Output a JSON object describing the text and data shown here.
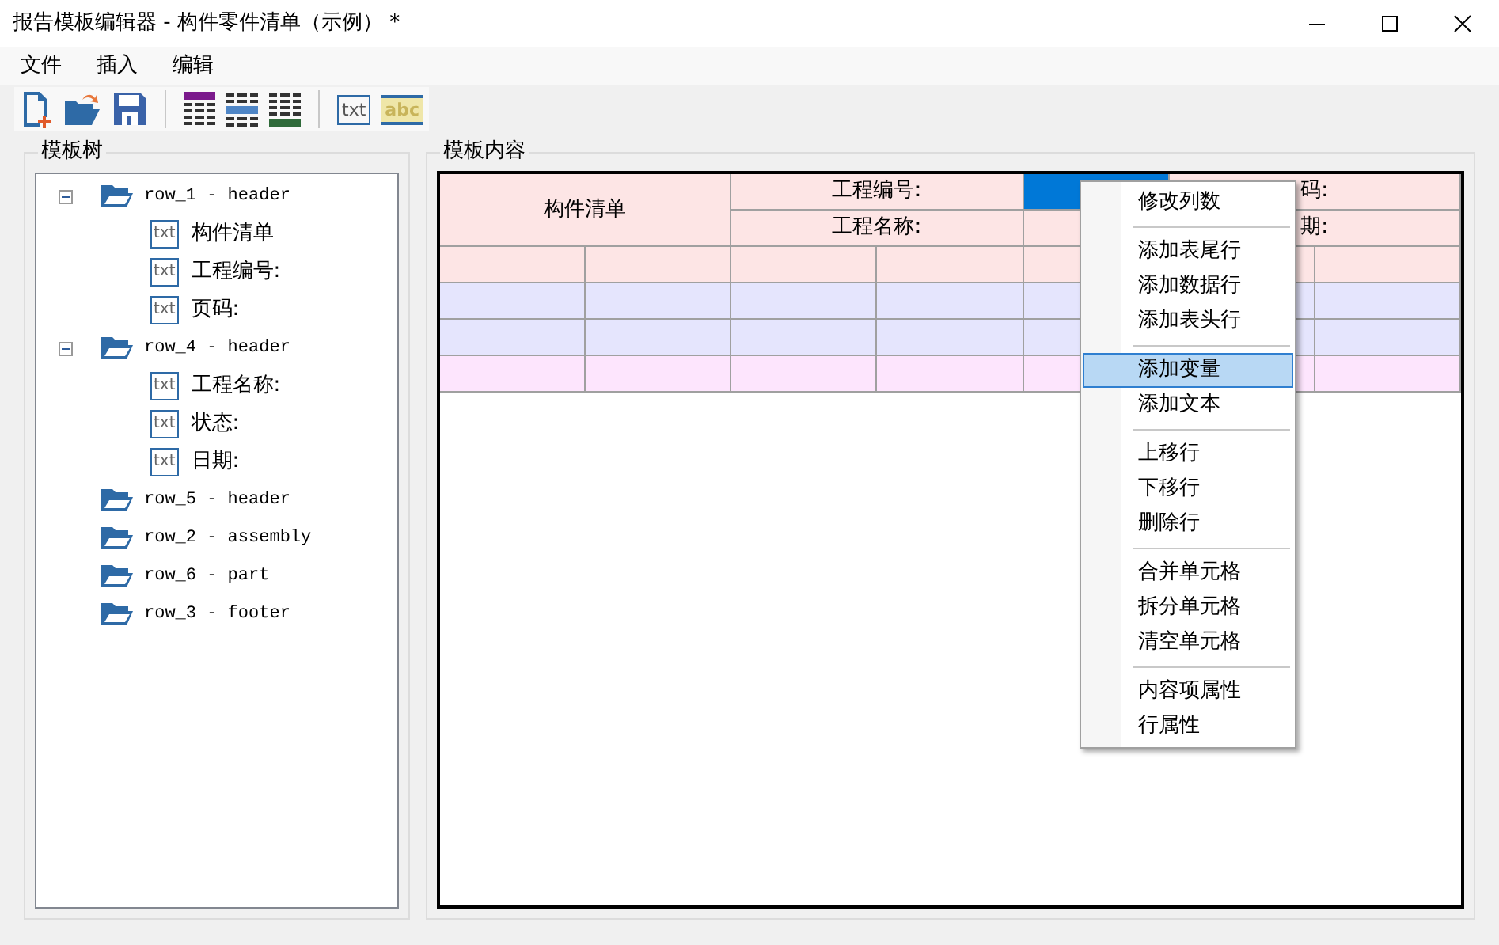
{
  "window": {
    "title": "报告模板编辑器 - 构件零件清单（示例） *"
  },
  "menu_bar": [
    "文件",
    "插入",
    "编辑"
  ],
  "toolbar": [
    {
      "kind": "new"
    },
    {
      "kind": "open"
    },
    {
      "kind": "save"
    },
    {
      "kind": "separator"
    },
    {
      "kind": "table-top"
    },
    {
      "kind": "table-middle"
    },
    {
      "kind": "table-bottom"
    },
    {
      "kind": "separator"
    },
    {
      "kind": "text",
      "label": "txt"
    },
    {
      "kind": "variable",
      "label": "abc"
    }
  ],
  "tree_panel": {
    "title": "模板树",
    "items": [
      {
        "label": "row_1 - header",
        "expanded": true,
        "children": [
          {
            "label": "构件清单",
            "badge": "txt"
          },
          {
            "label": "工程编号:",
            "badge": "txt"
          },
          {
            "label": "页码:",
            "badge": "txt"
          }
        ]
      },
      {
        "label": "row_4 - header",
        "expanded": true,
        "children": [
          {
            "label": "工程名称:",
            "badge": "txt"
          },
          {
            "label": "状态:",
            "badge": "txt"
          },
          {
            "label": "日期:",
            "badge": "txt"
          }
        ]
      },
      {
        "label": "row_5 - header"
      },
      {
        "label": "row_2 - assembly"
      },
      {
        "label": "row_6 - part"
      },
      {
        "label": "row_3 - footer"
      }
    ]
  },
  "content_panel": {
    "title": "模板内容",
    "table": {
      "rows": [
        {
          "color": "#fde5e5",
          "cells": [
            {
              "kind": "block",
              "text": "构件清单",
              "selected": false
            },
            {
              "kind": "wide",
              "text": "工程编号:",
              "selected": false
            },
            {
              "kind": "cell",
              "selected": true
            },
            {
              "kind": "wide",
              "text": "码:",
              "selected": false
            }
          ]
        },
        {
          "color": "#fde5e5",
          "cells": [
            {
              "kind": "merged"
            },
            {
              "kind": "wide",
              "text": "工程名称:",
              "selected": false
            },
            {
              "kind": "cell",
              "selected": false
            },
            {
              "kind": "wide",
              "text": "期:",
              "selected": false
            }
          ]
        },
        {
          "color": "#fde5e5",
          "cells": [
            {
              "selected": false
            },
            {
              "selected": false
            },
            {
              "selected": false
            },
            {
              "selected": false
            },
            {
              "selected": false
            },
            {
              "selected": false
            },
            {
              "selected": false
            }
          ]
        },
        {
          "color": "#e5e5fd",
          "cells": [
            {
              "selected": false
            },
            {
              "selected": false
            },
            {
              "selected": false
            },
            {
              "selected": false
            },
            {
              "selected": false
            },
            {
              "selected": false
            },
            {
              "selected": false
            }
          ]
        },
        {
          "color": "#e5e5fd",
          "cells": [
            {
              "selected": false
            },
            {
              "selected": false
            },
            {
              "selected": false
            },
            {
              "selected": false
            },
            {
              "selected": false
            },
            {
              "selected": false
            },
            {
              "selected": false
            }
          ]
        },
        {
          "color": "#fde5fd",
          "cells": [
            {
              "selected": false
            },
            {
              "selected": false
            },
            {
              "selected": false
            },
            {
              "selected": false
            },
            {
              "selected": false
            },
            {
              "selected": false
            },
            {
              "selected": false
            }
          ]
        }
      ]
    }
  },
  "context_menu": {
    "groups": [
      [
        {
          "label": "修改列数",
          "selected": false
        }
      ],
      [
        {
          "label": "添加表尾行",
          "selected": false
        },
        {
          "label": "添加数据行",
          "selected": false
        },
        {
          "label": "添加表头行",
          "selected": false
        }
      ],
      [
        {
          "label": "添加变量",
          "selected": true
        },
        {
          "label": "添加文本",
          "selected": false
        }
      ],
      [
        {
          "label": "上移行",
          "selected": false
        },
        {
          "label": "下移行",
          "selected": false
        },
        {
          "label": "删除行",
          "selected": false
        }
      ],
      [
        {
          "label": "合并单元格",
          "selected": false
        },
        {
          "label": "拆分单元格",
          "selected": false
        },
        {
          "label": "清空单元格",
          "selected": false
        }
      ],
      [
        {
          "label": "内容项属性",
          "selected": false
        },
        {
          "label": "行属性",
          "selected": false
        }
      ]
    ]
  }
}
